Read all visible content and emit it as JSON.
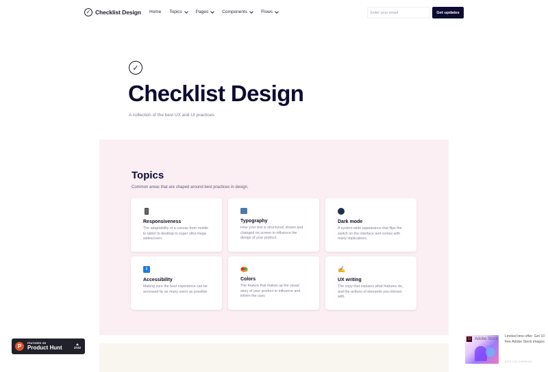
{
  "nav": {
    "brand": "Checklist Design",
    "links": [
      {
        "label": "Home",
        "has_dropdown": false
      },
      {
        "label": "Topics",
        "has_dropdown": true
      },
      {
        "label": "Pages",
        "has_dropdown": true
      },
      {
        "label": "Components",
        "has_dropdown": true
      },
      {
        "label": "Flows",
        "has_dropdown": true
      }
    ],
    "email_placeholder": "Enter your email",
    "email_value": "",
    "cta_label": "Get updates"
  },
  "hero": {
    "icon": "check-circle-icon",
    "title": "Checklist Design",
    "subtitle": "A collection of the best UX and UI practices."
  },
  "topics": {
    "title": "Topics",
    "subtitle": "Common areas that are shaped around best practices in design.",
    "cards": [
      {
        "icon": "mobile-phone-icon",
        "title": "Responsiveness",
        "description": "The adaptability of a canvas from mobile to tablet to desktop to super ultra mega widescreen."
      },
      {
        "icon": "abc-input-icon",
        "title": "Typography",
        "description": "How your text is structured, shown and changed on screen to influence the design of your product."
      },
      {
        "icon": "moon-icon",
        "title": "Dark mode",
        "description": "A system-wide appearance that flips the switch on the interface and comes with many implications."
      },
      {
        "icon": "info-icon",
        "title": "Accessibility",
        "description": "Making sure the best experience can be accessed by as many users as possible."
      },
      {
        "icon": "palette-icon",
        "title": "Colors",
        "description": "The feature that makes up the visual story of your product to influence and inform the user."
      },
      {
        "icon": "writing-hand-icon",
        "title": "UX writing",
        "description": "The copy that explains what features do, and the actions of elements you interact with."
      }
    ]
  },
  "product_hunt": {
    "featured_label": "FEATURED ON",
    "name": "Product Hunt",
    "upvotes": "3722"
  },
  "ad": {
    "brand": "Adobe Stock",
    "text": "Limited time offer: Get 10 free Adobe Stock images.",
    "via": "ADS VIA CARBON"
  },
  "colors": {
    "accent": "#0c0c33",
    "topics_bg": "#fbeff3",
    "lower_bg": "#f8f6ef",
    "product_hunt": "#da552f"
  }
}
